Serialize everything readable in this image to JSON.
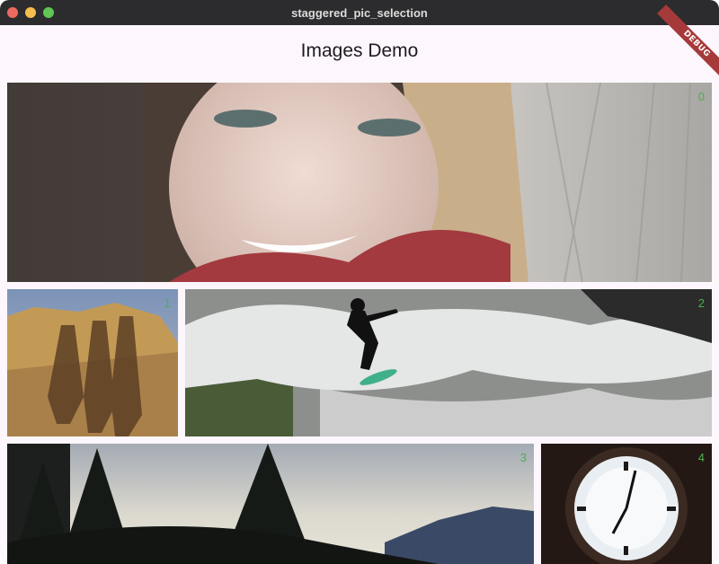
{
  "window": {
    "title": "staggered_pic_selection"
  },
  "appbar": {
    "title": "Images Demo"
  },
  "debug_banner": "DEBUG",
  "tiles": [
    {
      "index": "0",
      "subject": "smiling woman with red scarf in snowy forest"
    },
    {
      "index": "1",
      "subject": "shadows of three people on sandstone rocks"
    },
    {
      "index": "2",
      "subject": "surfer on river wave"
    },
    {
      "index": "3",
      "subject": "silhouette of pine trees and mountains at dusk"
    },
    {
      "index": "4",
      "subject": "backlit clock face with roman numerals"
    }
  ]
}
